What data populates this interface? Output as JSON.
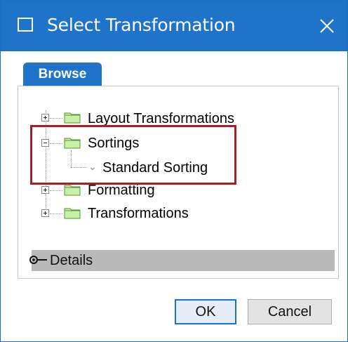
{
  "window": {
    "title": "Select Transformation",
    "accent_color": "#1f73c9",
    "close_icon": "close-icon"
  },
  "tabs": [
    {
      "label": "Browse",
      "active": true
    }
  ],
  "tree": {
    "items": [
      {
        "label": "Layout Transformations",
        "expander": "plus",
        "icon": "folder-icon"
      },
      {
        "label": "Sortings",
        "expander": "minus",
        "icon": "folder-icon",
        "children": [
          {
            "label": "Standard Sorting",
            "icon": "chevron-down-icon"
          }
        ]
      },
      {
        "label": "Formatting",
        "expander": "plus",
        "icon": "folder-icon"
      },
      {
        "label": "Transformations",
        "expander": "plus",
        "icon": "folder-icon"
      }
    ],
    "highlight_color": "#a3202a"
  },
  "details": {
    "label": "Details",
    "icon": "radio-toggle-icon"
  },
  "buttons": {
    "ok": "OK",
    "cancel": "Cancel"
  }
}
